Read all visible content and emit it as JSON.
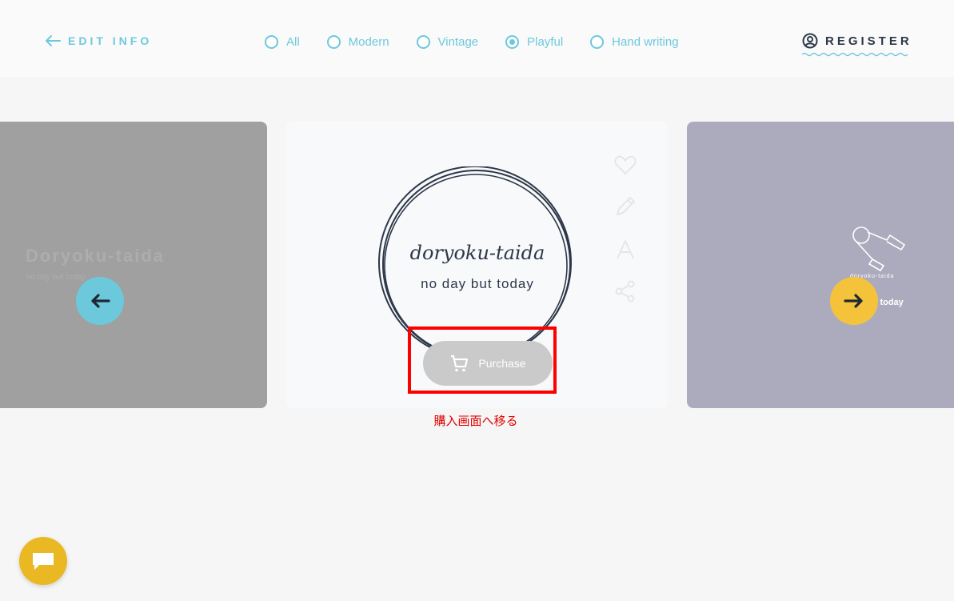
{
  "header": {
    "edit_info_label": "EDIT INFO",
    "register_label": "REGISTER",
    "style_options": [
      {
        "label": "All",
        "checked": false
      },
      {
        "label": "Modern",
        "checked": false
      },
      {
        "label": "Vintage",
        "checked": false
      },
      {
        "label": "Playful",
        "checked": true
      },
      {
        "label": "Hand writing",
        "checked": false
      }
    ]
  },
  "cards": {
    "left": {
      "title": "Doryoku-taida",
      "subtitle": "no day but today"
    },
    "center": {
      "title": "doryoku-taida",
      "subtitle": "no day but today",
      "purchase_label": "Purchase",
      "side_icons": [
        "heart-icon",
        "pencil-icon",
        "font-icon",
        "share-icon"
      ]
    },
    "right": {
      "logo_text": "doryoku-taida",
      "subtitle": "ut today"
    }
  },
  "annotation": {
    "text": "購入画面へ移る"
  },
  "colors": {
    "accent": "#6cc9dc",
    "dark": "#2d3748",
    "arrow_left": "#6cc9dc",
    "arrow_right": "#f5c33b",
    "chat": "#e9b823",
    "annotation": "#ff0000"
  }
}
